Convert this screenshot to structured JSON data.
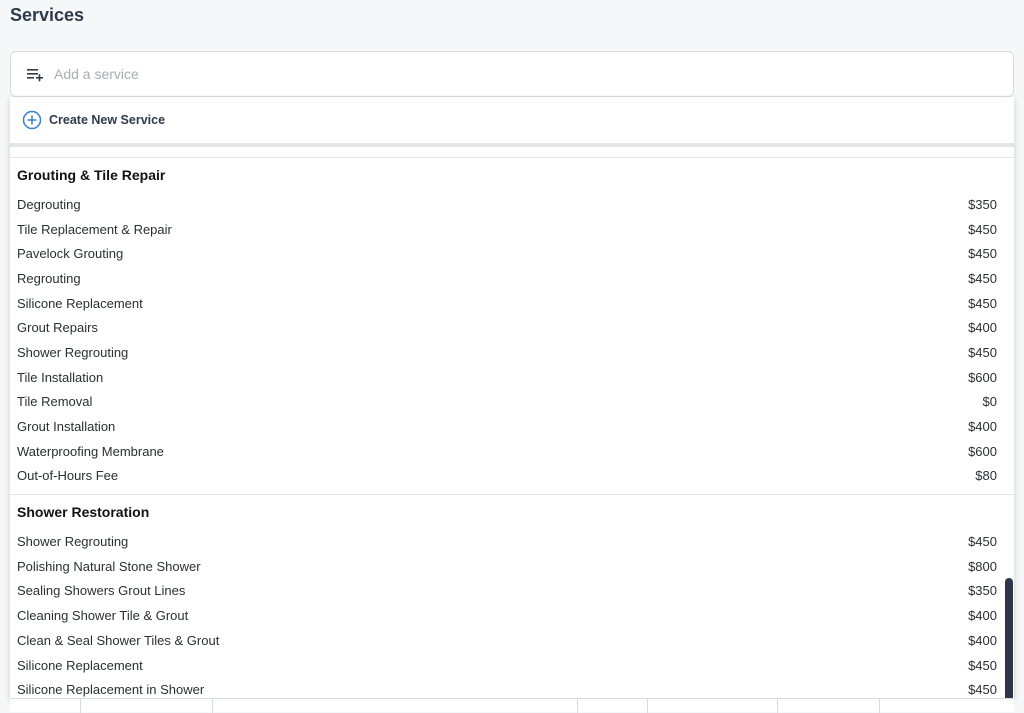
{
  "page": {
    "title": "Services"
  },
  "search": {
    "placeholder": "Add a service"
  },
  "dropdown": {
    "create_label": "Create New Service",
    "groups": [
      {
        "name": "Grouting & Tile Repair",
        "items": [
          {
            "label": "Degrouting",
            "price": "$350"
          },
          {
            "label": "Tile Replacement & Repair",
            "price": "$450"
          },
          {
            "label": "Pavelock Grouting",
            "price": "$450"
          },
          {
            "label": "Regrouting",
            "price": "$450"
          },
          {
            "label": "Silicone Replacement",
            "price": "$450"
          },
          {
            "label": "Grout Repairs",
            "price": "$400"
          },
          {
            "label": "Shower Regrouting",
            "price": "$450"
          },
          {
            "label": "Tile Installation",
            "price": "$600"
          },
          {
            "label": "Tile Removal",
            "price": "$0"
          },
          {
            "label": "Grout Installation",
            "price": "$400"
          },
          {
            "label": "Waterproofing Membrane",
            "price": "$600"
          },
          {
            "label": "Out-of-Hours Fee",
            "price": "$80"
          }
        ]
      },
      {
        "name": "Shower Restoration",
        "items": [
          {
            "label": "Shower Regrouting",
            "price": "$450"
          },
          {
            "label": "Polishing Natural Stone Shower",
            "price": "$800"
          },
          {
            "label": "Sealing Showers Grout Lines",
            "price": "$350"
          },
          {
            "label": "Cleaning Shower Tile & Grout",
            "price": "$400"
          },
          {
            "label": "Clean & Seal Shower Tiles & Grout",
            "price": "$400"
          },
          {
            "label": "Silicone Replacement",
            "price": "$450"
          },
          {
            "label": "Silicone Replacement in Shower",
            "price": "$450"
          }
        ]
      }
    ]
  },
  "colors": {
    "accent": "#3b82c4",
    "scrollbar": "#2d3748"
  },
  "icons": {
    "search_field": "playlist-add-icon",
    "create": "plus-circle-icon"
  }
}
